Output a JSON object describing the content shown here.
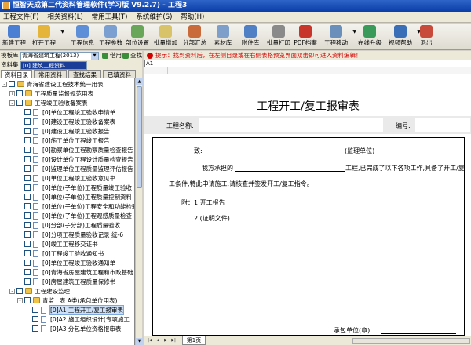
{
  "window": {
    "title": "恒智天成第二代资料管理软件(学习版 V9.2.7) - 工程3"
  },
  "menu": [
    "工程文件(F)",
    "相关资料(L)",
    "常用工具(T)",
    "系统维护(S)",
    "帮助(H)"
  ],
  "toolbar": [
    {
      "label": "新建工程",
      "icon": "new-project-icon",
      "color": "#4a7fd4"
    },
    {
      "label": "打开工程",
      "icon": "open-folder-icon",
      "color": "#e5b43a",
      "dropdown": true
    },
    {
      "label": "工程信息",
      "icon": "project-info-icon",
      "color": "#5d8fd8"
    },
    {
      "label": "工程参数",
      "icon": "project-params-icon",
      "color": "#7a9fd0"
    },
    {
      "label": "部位设置",
      "icon": "location-settings-icon",
      "color": "#6aa65a"
    },
    {
      "label": "批量增加",
      "icon": "batch-add-icon",
      "color": "#d8c36a"
    },
    {
      "label": "分部汇总",
      "icon": "summary-icon",
      "color": "#c86a3a"
    },
    {
      "label": "素材库",
      "icon": "material-library-icon",
      "color": "#7d9fca"
    },
    {
      "label": "附件库",
      "icon": "attachment-library-icon",
      "color": "#4f80c6"
    },
    {
      "label": "批量打印",
      "icon": "batch-print-icon",
      "color": "#8a8a8a"
    },
    {
      "label": "PDF档案",
      "icon": "pdf-archive-icon",
      "color": "#c8352b"
    },
    {
      "label": "工程移动",
      "icon": "project-move-icon",
      "color": "#6a8fba",
      "dropdown": true
    },
    {
      "label": "在线升级",
      "icon": "online-upgrade-icon",
      "color": "#3a9a5a"
    },
    {
      "label": "视频帮助",
      "icon": "video-help-icon",
      "color": "#3a6fb8",
      "dropdown": true
    },
    {
      "label": "退出",
      "icon": "exit-icon",
      "color": "#c84a3a"
    }
  ],
  "left": {
    "template_label": "模板库",
    "template_value": "青海省建筑工程(2013)",
    "borrow_label": "借用",
    "search_label": "查找",
    "materials_label": "资料集",
    "materials_value": "[0] 建筑工程资料",
    "tabs": [
      "资料目录",
      "常用资料",
      "查找结果",
      "已填资料"
    ]
  },
  "tree": [
    {
      "level": 0,
      "kind": "folder",
      "expand": "-",
      "text": "青海省建设工程技术统一用表"
    },
    {
      "level": 1,
      "kind": "folder",
      "expand": "+",
      "text": "工程质量监督规范用表"
    },
    {
      "level": 1,
      "kind": "folder",
      "expand": "-",
      "text": "工程竣工验收备案表"
    },
    {
      "level": 2,
      "kind": "doc",
      "text": "[0]单位工程竣工验收申请单"
    },
    {
      "level": 2,
      "kind": "doc",
      "text": "[0]建设工程竣工验收备案表"
    },
    {
      "level": 2,
      "kind": "doc",
      "text": "[0]建设工程竣工验收报告"
    },
    {
      "level": 2,
      "kind": "doc",
      "text": "[0]施工单位工程竣工报告"
    },
    {
      "level": 2,
      "kind": "doc",
      "text": "[0]勘察单位工程勘察质量检查报告"
    },
    {
      "level": 2,
      "kind": "doc",
      "text": "[0]设计单位工程设计质量检查报告"
    },
    {
      "level": 2,
      "kind": "doc",
      "text": "[0]监理单位工程质量监理评估报告"
    },
    {
      "level": 2,
      "kind": "doc",
      "text": "[0]单位工程竣工验收意见书"
    },
    {
      "level": 2,
      "kind": "doc",
      "text": "[0]单位(子单位)工程质量竣工验收"
    },
    {
      "level": 2,
      "kind": "doc",
      "text": "[0]单位(子单位)工程质量控制资料"
    },
    {
      "level": 2,
      "kind": "doc",
      "text": "[0]单位(子单位)工程安全和功能检验"
    },
    {
      "level": 2,
      "kind": "doc",
      "text": "[0]单位(子单位)工程观感质量检查"
    },
    {
      "level": 2,
      "kind": "doc",
      "text": "[0]分部(子分部)工程质量验收"
    },
    {
      "level": 2,
      "kind": "doc",
      "text": "[0]分项工程质量验收记录 统-6"
    },
    {
      "level": 2,
      "kind": "doc",
      "text": "[0]竣工工程移交证书"
    },
    {
      "level": 2,
      "kind": "doc",
      "text": "[0]工程竣工验收通知书"
    },
    {
      "level": 2,
      "kind": "doc",
      "text": "[0]单位工程竣工验收通知单"
    },
    {
      "level": 2,
      "kind": "doc",
      "text": "[0]青海省房屋建筑工程和市政基础"
    },
    {
      "level": 2,
      "kind": "doc",
      "text": "[0]房屋建筑工程质量保修书"
    },
    {
      "level": 1,
      "kind": "folder",
      "expand": "-",
      "text": "工程建设监理"
    },
    {
      "level": 2,
      "kind": "folder",
      "expand": "-",
      "text": "表 A类(承包单位用表)",
      "prefix": "青监"
    },
    {
      "level": 3,
      "kind": "doc",
      "text": "[0]A1 工程开工/复工报审表",
      "selected": true
    },
    {
      "level": 3,
      "kind": "doc",
      "text": "[0]A2 施工组织设计(专项施工"
    },
    {
      "level": 3,
      "kind": "doc",
      "text": "[0]A3 分包单位资格报审表"
    }
  ],
  "notice": "提示：找到资料后，在左侧目录或在右侧表格预览界面双击即可进入资料编辑！",
  "cell_ref": "A1",
  "doc": {
    "title": "工程开工/复工报审表",
    "project_name_label": "工程名称:",
    "number_label": "编号:",
    "to_label": "致:",
    "supervision_unit": "(监理单位)",
    "paragraph_a": "我方承担的",
    "paragraph_b": "工程,已完成了以下各项工作,具备了开工/复",
    "paragraph_c": "工条件,特此申请施工,请核查并签发开工/复工指令。",
    "attach_label": "附：1.开工报告",
    "attach_2": "2.(证明文件)",
    "contractor_label": "承包单位(章)"
  },
  "sheet_tab": "第1页"
}
